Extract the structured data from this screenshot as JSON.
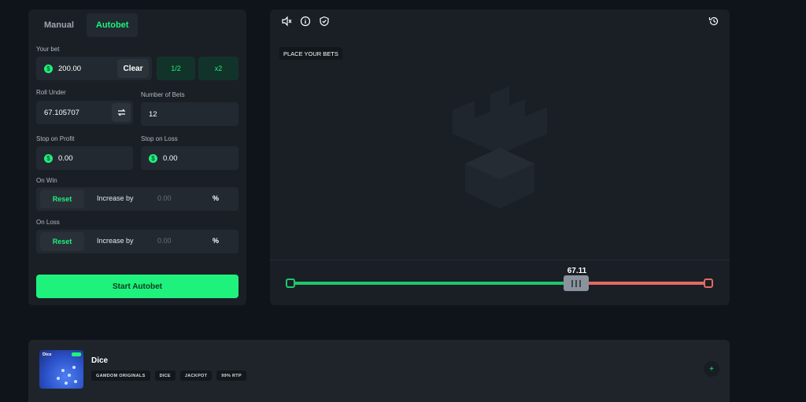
{
  "tabs": [
    {
      "label": "Manual",
      "active": false
    },
    {
      "label": "Autobet",
      "active": true
    }
  ],
  "bet": {
    "label": "Your bet",
    "value": "200.00",
    "clear_label": "Clear",
    "half_label": "1/2",
    "double_label": "x2"
  },
  "roll_under": {
    "label": "Roll Under",
    "value": "67.105707"
  },
  "number_of_bets": {
    "label": "Number of Bets",
    "value": "12"
  },
  "stop_profit": {
    "label": "Stop on Profit",
    "value": "0.00"
  },
  "stop_loss": {
    "label": "Stop on Loss",
    "value": "0.00"
  },
  "on_win": {
    "label": "On Win",
    "reset_label": "Reset",
    "increase_label": "Increase by",
    "value": "0.00",
    "unit": "%"
  },
  "on_loss": {
    "label": "On Loss",
    "reset_label": "Reset",
    "increase_label": "Increase by",
    "value": "0.00",
    "unit": "%"
  },
  "start_label": "Start Autobet",
  "coin_symbol": "$",
  "game_area": {
    "place_bets_label": "PLACE YOUR BETS",
    "slider_value": "67.11",
    "slider_fraction": 0.6711,
    "icons": [
      "sound-icon",
      "info-icon",
      "shield-check-icon",
      "history-icon"
    ]
  },
  "game_card": {
    "title": "Dice",
    "thumbnail_tag": "Dice",
    "chips": [
      "GAMDOM ORIGINALS",
      "DICE",
      "JACKPOT",
      "99% RTP"
    ],
    "plus_label": "+"
  },
  "colors": {
    "accent": "#1ef27c",
    "win_track": "#1ec86a",
    "loss_track": "#e36a63",
    "panel": "#1a1f26",
    "background": "#0f141a"
  }
}
